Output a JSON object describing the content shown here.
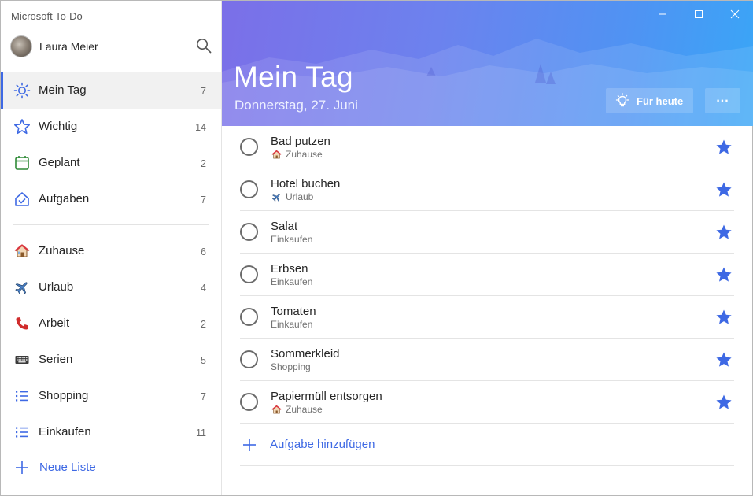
{
  "app": {
    "title": "Microsoft To-Do"
  },
  "profile": {
    "name": "Laura Meier"
  },
  "sidebar": {
    "smart_lists": [
      {
        "label": "Mein Tag",
        "count": "7",
        "icon": "sun-icon",
        "active": true
      },
      {
        "label": "Wichtig",
        "count": "14",
        "icon": "star-outline-icon"
      },
      {
        "label": "Geplant",
        "count": "2",
        "icon": "calendar-icon"
      },
      {
        "label": "Aufgaben",
        "count": "7",
        "icon": "house-check-icon"
      }
    ],
    "lists": [
      {
        "label": "Zuhause",
        "count": "6",
        "icon": "house-emoji-icon"
      },
      {
        "label": "Urlaub",
        "count": "4",
        "icon": "airplane-emoji-icon"
      },
      {
        "label": "Arbeit",
        "count": "2",
        "icon": "telephone-emoji-icon"
      },
      {
        "label": "Serien",
        "count": "5",
        "icon": "keyboard-emoji-icon"
      },
      {
        "label": "Shopping",
        "count": "7",
        "icon": "list-icon"
      },
      {
        "label": "Einkaufen",
        "count": "11",
        "icon": "list-icon"
      }
    ],
    "new_list_label": "Neue Liste"
  },
  "header": {
    "title": "Mein Tag",
    "date": "Donnerstag, 27. Juni",
    "today_button_label": "Für heute",
    "more_button_label": "..."
  },
  "tasks": [
    {
      "title": "Bad putzen",
      "list": "Zuhause",
      "list_icon": "house-emoji-icon",
      "important": true
    },
    {
      "title": "Hotel buchen",
      "list": "Urlaub",
      "list_icon": "airplane-emoji-icon",
      "important": true
    },
    {
      "title": "Salat",
      "list": "Einkaufen",
      "list_icon": "",
      "important": true
    },
    {
      "title": "Erbsen",
      "list": "Einkaufen",
      "list_icon": "",
      "important": true
    },
    {
      "title": "Tomaten",
      "list": "Einkaufen",
      "list_icon": "",
      "important": true
    },
    {
      "title": "Sommerkleid",
      "list": "Shopping",
      "list_icon": "",
      "important": true
    },
    {
      "title": "Papiermüll entsorgen",
      "list": "Zuhause",
      "list_icon": "house-emoji-icon",
      "important": true
    }
  ],
  "add_task_label": "Aufgabe hinzufügen",
  "colors": {
    "accent": "#3e69e4",
    "header_start": "#7b6fe8",
    "header_end": "#39a6f7",
    "star": "#3e69e4"
  }
}
